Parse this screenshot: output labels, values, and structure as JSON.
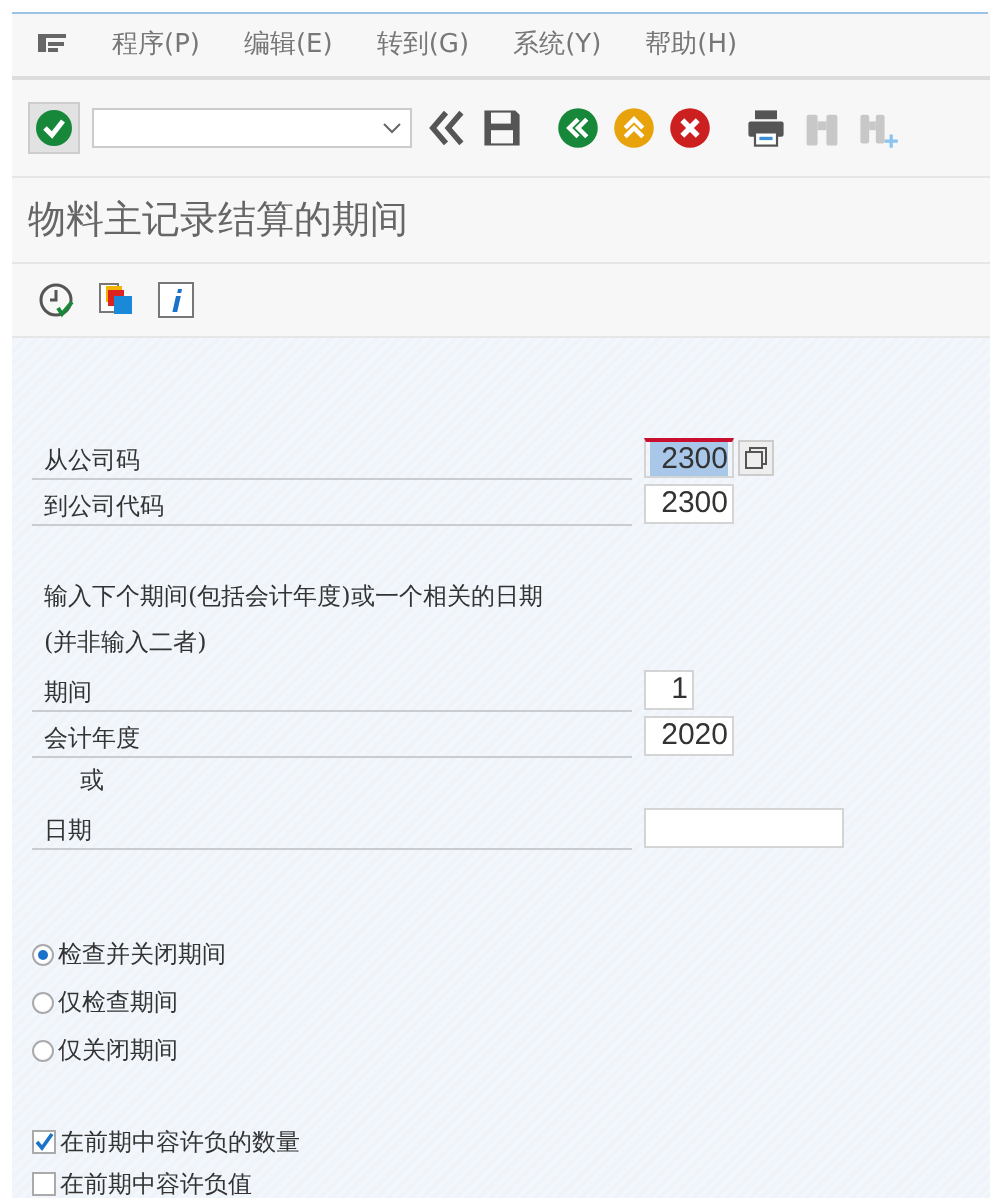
{
  "menu_bar": {
    "items": [
      "程序(P)",
      "编辑(E)",
      "转到(G)",
      "系统(Y)",
      "帮助(H)"
    ]
  },
  "toolbar": {
    "buttons": [
      {
        "kind": "back-double",
        "disabled": false
      },
      {
        "kind": "save",
        "disabled": false
      },
      {
        "kind": "back",
        "disabled": false
      },
      {
        "kind": "exit",
        "disabled": false
      },
      {
        "kind": "cancel",
        "disabled": false
      },
      {
        "kind": "print",
        "disabled": false
      },
      {
        "kind": "find",
        "disabled": true
      },
      {
        "kind": "find-next",
        "disabled": true
      }
    ]
  },
  "title": "物料主记录结算的期间",
  "app_toolbar": [
    {
      "kind": "execute"
    },
    {
      "kind": "variants"
    },
    {
      "kind": "info"
    }
  ],
  "form": [
    {
      "kind": "code-field",
      "label": "从公司码",
      "value": "2300",
      "focused": true,
      "range_button": true
    },
    {
      "kind": "code-field",
      "label": "到公司代码",
      "value": "2300",
      "focused": false,
      "range_button": false
    },
    {
      "kind": "gap"
    },
    {
      "kind": "note",
      "text": "输入下个期间(包括会计年度)或一个相关的日期"
    },
    {
      "kind": "note",
      "text": "(并非输入二者)"
    },
    {
      "kind": "period-field",
      "label": "期间",
      "value": "1",
      "focused": false,
      "range_button": false
    },
    {
      "kind": "year-field",
      "label": "会计年度",
      "value": "2020",
      "focused": false,
      "range_button": false
    },
    {
      "kind": "or",
      "text": "或"
    },
    {
      "kind": "date-field",
      "label": "日期",
      "focused": false,
      "range_button": false
    }
  ],
  "radios": [
    {
      "label": "检查并关闭期间",
      "selected": true
    },
    {
      "label": "仅检查期间",
      "selected": false
    },
    {
      "label": "仅关闭期间",
      "selected": false
    }
  ],
  "checkboxes": [
    {
      "label": "在前期中容许负的数量",
      "checked": true
    },
    {
      "label": "在前期中容许负值",
      "checked": false
    }
  ]
}
